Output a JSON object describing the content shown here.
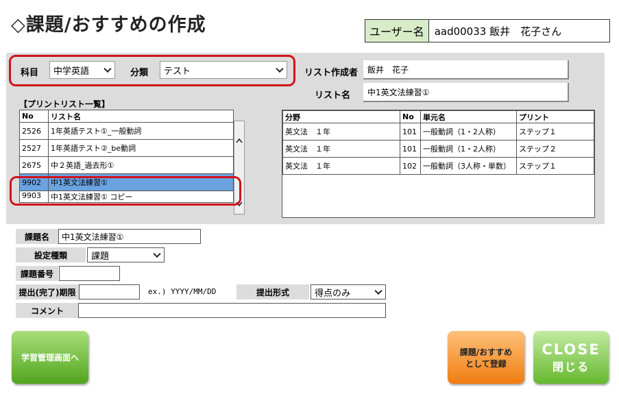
{
  "title": "◇課題/おすすめの作成",
  "user": {
    "label": "ユーザー名",
    "value": "aad00033 飯井　花子さん"
  },
  "filters": {
    "subject_label": "科目",
    "subject_value": "中学英語",
    "category_label": "分類",
    "category_value": "テスト"
  },
  "list_info": {
    "author_label": "リスト作成者",
    "author_value": "飯井　花子",
    "name_label": "リスト名",
    "name_value": "中1英文法練習①"
  },
  "print_list": {
    "heading": "【プリントリスト一覧】",
    "columns": [
      "No",
      "リスト名"
    ],
    "rows": [
      {
        "no": "2526",
        "name": "1年英語テスト①_一般動詞"
      },
      {
        "no": "2527",
        "name": "1年英語テスト②_be動詞"
      },
      {
        "no": "2675",
        "name": "中２英語_過去形①"
      },
      {
        "no": "9902",
        "name": "中1英文法練習①"
      },
      {
        "no": "9903",
        "name": "中1英文法練習① コピー"
      }
    ]
  },
  "detail_table": {
    "columns": [
      "分野",
      "No",
      "単元名",
      "プリント"
    ],
    "rows": [
      {
        "field": "英文法　１年",
        "no": "101",
        "unit": "一般動詞（1・2人称）",
        "print": "ステップ１"
      },
      {
        "field": "英文法　１年",
        "no": "101",
        "unit": "一般動詞（1・2人称）",
        "print": "ステップ２"
      },
      {
        "field": "英文法　１年",
        "no": "102",
        "unit": "一般動詞（3人称・単数）",
        "print": "ステップ１"
      }
    ]
  },
  "form": {
    "task_name_label": "課題名",
    "task_name_value": "中1英文法練習①",
    "setting_type_label": "設定種類",
    "setting_type_value": "課題",
    "task_number_label": "課題番号",
    "task_number_value": "",
    "deadline_label": "提出(完了)期限",
    "deadline_value": "",
    "deadline_hint": "ex.) YYYY/MM/DD",
    "submit_format_label": "提出形式",
    "submit_format_value": "得点のみ",
    "comment_label": "コメント",
    "comment_value": ""
  },
  "buttons": {
    "study": "学習管理画面へ",
    "register_line1": "課題/おすすめ",
    "register_line2": "として登録",
    "close_en": "CLOSE",
    "close_jp": "閉じる"
  },
  "colors": {
    "panel": "#dcdcdc",
    "highlight": "#d0121b",
    "selected_row": "#6aa3e0",
    "user_label_bg": "#d8ecc8"
  }
}
